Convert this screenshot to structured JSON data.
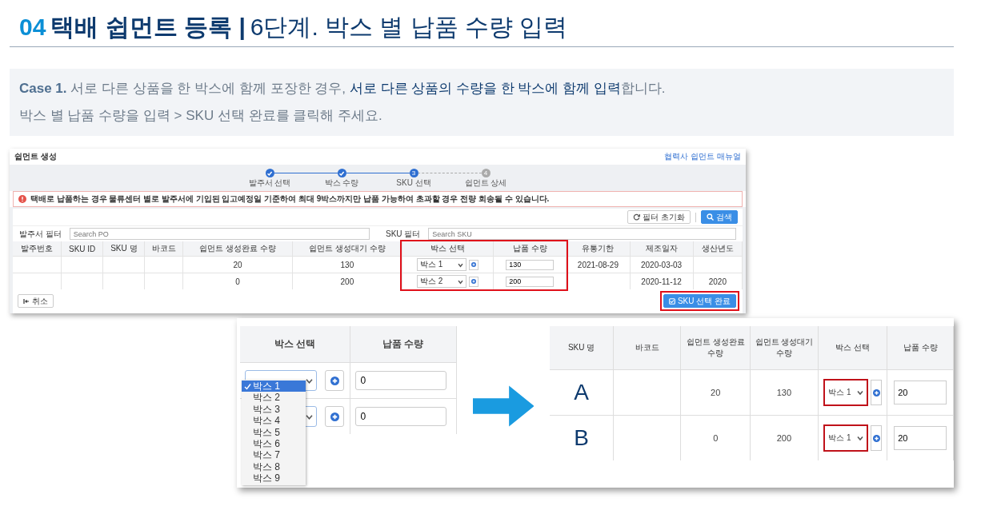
{
  "header": {
    "number": "04",
    "title": "택배 쉽먼트 등록 |",
    "subtitle": "6단계. 박스 별 납품 수량 입력"
  },
  "note": {
    "lines": [
      "**Case 1.** 서로 다른 상품을 한 박스에 함께 포장한 경우, **서로 다른 상품의 수량을 한 박스에 함께 입력**합니다.",
      "박스 별 납품 수량을 입력 > SKU 선택 완료를 클릭해 주세요."
    ]
  },
  "screenshot": {
    "title": "쉽먼트 생성",
    "manual_link": "협력사 쉽먼트 매뉴얼",
    "steps": [
      {
        "label": "발주서 선택",
        "completed": true,
        "current": false
      },
      {
        "label": "박스 수량",
        "completed": true,
        "current": false
      },
      {
        "label": "SKU 선택",
        "completed": false,
        "current": true,
        "number": "3"
      },
      {
        "label": "쉽먼트 상세",
        "completed": false,
        "current": false,
        "number": "4"
      }
    ],
    "alert": "택배로 납품하는 경우 물류센터 별로 발주서에 기입된 입고예정일 기준하여 최대 9박스까지만 납품 가능하여 초과할 경우 전량 회송될 수 있습니다.",
    "reset_button": "필터 초기화",
    "search_button": "검색",
    "filters": [
      {
        "label": "발주서 필터",
        "placeholder": "Search PO"
      },
      {
        "label": "SKU 필터",
        "placeholder": "Search SKU"
      }
    ],
    "columns": [
      {
        "label": "발주번호",
        "kind": "text",
        "highlighted": false
      },
      {
        "label": "SKU ID",
        "kind": "text",
        "highlighted": false
      },
      {
        "label": "SKU 명",
        "kind": "text",
        "highlighted": false
      },
      {
        "label": "바코드",
        "kind": "text",
        "highlighted": false
      },
      {
        "label": "쉽먼트 생성완료 수량",
        "kind": "text",
        "highlighted": false
      },
      {
        "label": "쉽먼트 생성대기 수량",
        "kind": "text",
        "highlighted": false
      },
      {
        "label": "박스 선택",
        "kind": "select",
        "highlighted": true
      },
      {
        "label": "납품 수량",
        "kind": "input",
        "highlighted": true
      },
      {
        "label": "유통기한",
        "kind": "text",
        "highlighted": false
      },
      {
        "label": "제조일자",
        "kind": "text",
        "highlighted": false
      },
      {
        "label": "생산년도",
        "kind": "text",
        "highlighted": false
      }
    ],
    "rows": [
      {
        "cells": {
          "4": "20",
          "5": "130",
          "6": "박스 1",
          "7": "130",
          "8": "2021-08-29",
          "9": "2020-03-03"
        }
      },
      {
        "cells": {
          "4": "0",
          "5": "200",
          "6": "박스 2",
          "7": "200",
          "9": "2020-11-12",
          "10": "2020"
        }
      }
    ],
    "cancel_button": "취소",
    "complete_button": {
      "label": "SKU 선택 완료",
      "highlighted": true
    }
  },
  "example": {
    "before": {
      "columns": [
        "박스 선택",
        "납품 수량"
      ],
      "rows": [
        {
          "qty": "0"
        },
        {
          "qty": "0"
        }
      ],
      "dropdown": [
        {
          "label": "박스 1",
          "selected": true
        },
        {
          "label": "박스 2",
          "selected": false
        },
        {
          "label": "박스 3",
          "selected": false
        },
        {
          "label": "박스 4",
          "selected": false
        },
        {
          "label": "박스 5",
          "selected": false
        },
        {
          "label": "박스 6",
          "selected": false
        },
        {
          "label": "박스 7",
          "selected": false
        },
        {
          "label": "박스 8",
          "selected": false
        },
        {
          "label": "박스 9",
          "selected": false
        }
      ]
    },
    "after": {
      "columns": [
        "SKU 명",
        "바코드",
        "쉽먼트 생성완료 수량",
        "쉽먼트 생성대기 수량",
        "박스 선택",
        "납품 수량"
      ],
      "rows": [
        {
          "sku": "A",
          "done_qty": "20",
          "wait_qty": "130",
          "box": "박스 1",
          "box_highlighted": true,
          "qty": "20"
        },
        {
          "sku": "B",
          "done_qty": "0",
          "wait_qty": "200",
          "box": "박스 1",
          "box_highlighted": true,
          "qty": "20"
        }
      ]
    }
  }
}
